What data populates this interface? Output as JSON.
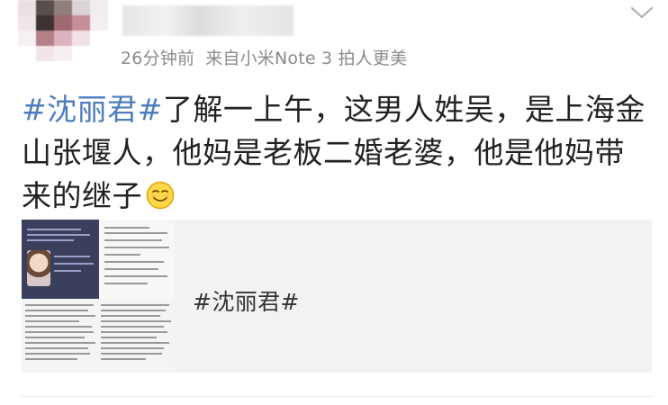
{
  "post": {
    "meta": {
      "time": "26分钟前",
      "source": "来自小米Note 3 拍人更美"
    },
    "hashtag": "#沈丽君#",
    "body": "了解一上午，这男人姓吴，是上海金山张堰人，他妈是老板二婚老婆，他是他妈带来的继子",
    "emoji": "smirk-emoji"
  },
  "link_card": {
    "title": "#沈丽君#"
  },
  "icons": {
    "menu": "chevron-down-icon"
  },
  "colors": {
    "hashtag": "#4d7dbd",
    "meta_text": "#8b8b8b",
    "body_text": "#222222",
    "card_bg": "#f2f2f2"
  }
}
